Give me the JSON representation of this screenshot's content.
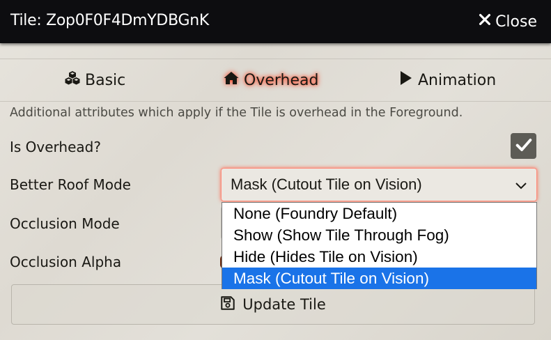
{
  "window": {
    "title": "Tile: Zop0F0F4DmYDBGnK",
    "close_label": "Close"
  },
  "tabs": [
    {
      "label": "Basic",
      "icon": "cubes-icon",
      "active": false
    },
    {
      "label": "Overhead",
      "icon": "home-icon",
      "active": true
    },
    {
      "label": "Animation",
      "icon": "play-icon",
      "active": false
    }
  ],
  "overhead": {
    "hint": "Additional attributes which apply if the Tile is overhead in the Foreground.",
    "is_overhead_label": "Is Overhead?",
    "is_overhead_checked": true,
    "roof_mode_label": "Better Roof Mode",
    "roof_mode_value": "Mask (Cutout Tile on Vision)",
    "roof_mode_options": [
      "None (Foundry Default)",
      "Show (Show Tile Through Fog)",
      "Hide (Hides Tile on Vision)",
      "Mask (Cutout Tile on Vision)"
    ],
    "occlusion_mode_label": "Occlusion Mode",
    "occlusion_alpha_label": "Occlusion Alpha"
  },
  "footer": {
    "update_label": "Update Tile"
  },
  "colors": {
    "header_bg": "#0d0d10",
    "active_glow": "#ff3a1a",
    "option_selected": "#1a73e8"
  }
}
